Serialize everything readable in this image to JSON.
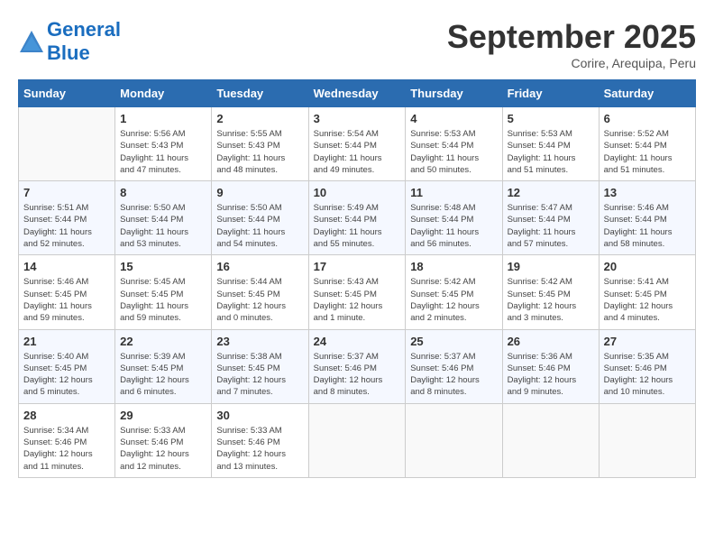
{
  "header": {
    "logo_line1": "General",
    "logo_line2": "Blue",
    "month": "September 2025",
    "location": "Corire, Arequipa, Peru"
  },
  "weekdays": [
    "Sunday",
    "Monday",
    "Tuesday",
    "Wednesday",
    "Thursday",
    "Friday",
    "Saturday"
  ],
  "weeks": [
    [
      {
        "day": "",
        "info": ""
      },
      {
        "day": "1",
        "info": "Sunrise: 5:56 AM\nSunset: 5:43 PM\nDaylight: 11 hours\nand 47 minutes."
      },
      {
        "day": "2",
        "info": "Sunrise: 5:55 AM\nSunset: 5:43 PM\nDaylight: 11 hours\nand 48 minutes."
      },
      {
        "day": "3",
        "info": "Sunrise: 5:54 AM\nSunset: 5:44 PM\nDaylight: 11 hours\nand 49 minutes."
      },
      {
        "day": "4",
        "info": "Sunrise: 5:53 AM\nSunset: 5:44 PM\nDaylight: 11 hours\nand 50 minutes."
      },
      {
        "day": "5",
        "info": "Sunrise: 5:53 AM\nSunset: 5:44 PM\nDaylight: 11 hours\nand 51 minutes."
      },
      {
        "day": "6",
        "info": "Sunrise: 5:52 AM\nSunset: 5:44 PM\nDaylight: 11 hours\nand 51 minutes."
      }
    ],
    [
      {
        "day": "7",
        "info": "Sunrise: 5:51 AM\nSunset: 5:44 PM\nDaylight: 11 hours\nand 52 minutes."
      },
      {
        "day": "8",
        "info": "Sunrise: 5:50 AM\nSunset: 5:44 PM\nDaylight: 11 hours\nand 53 minutes."
      },
      {
        "day": "9",
        "info": "Sunrise: 5:50 AM\nSunset: 5:44 PM\nDaylight: 11 hours\nand 54 minutes."
      },
      {
        "day": "10",
        "info": "Sunrise: 5:49 AM\nSunset: 5:44 PM\nDaylight: 11 hours\nand 55 minutes."
      },
      {
        "day": "11",
        "info": "Sunrise: 5:48 AM\nSunset: 5:44 PM\nDaylight: 11 hours\nand 56 minutes."
      },
      {
        "day": "12",
        "info": "Sunrise: 5:47 AM\nSunset: 5:44 PM\nDaylight: 11 hours\nand 57 minutes."
      },
      {
        "day": "13",
        "info": "Sunrise: 5:46 AM\nSunset: 5:44 PM\nDaylight: 11 hours\nand 58 minutes."
      }
    ],
    [
      {
        "day": "14",
        "info": "Sunrise: 5:46 AM\nSunset: 5:45 PM\nDaylight: 11 hours\nand 59 minutes."
      },
      {
        "day": "15",
        "info": "Sunrise: 5:45 AM\nSunset: 5:45 PM\nDaylight: 11 hours\nand 59 minutes."
      },
      {
        "day": "16",
        "info": "Sunrise: 5:44 AM\nSunset: 5:45 PM\nDaylight: 12 hours\nand 0 minutes."
      },
      {
        "day": "17",
        "info": "Sunrise: 5:43 AM\nSunset: 5:45 PM\nDaylight: 12 hours\nand 1 minute."
      },
      {
        "day": "18",
        "info": "Sunrise: 5:42 AM\nSunset: 5:45 PM\nDaylight: 12 hours\nand 2 minutes."
      },
      {
        "day": "19",
        "info": "Sunrise: 5:42 AM\nSunset: 5:45 PM\nDaylight: 12 hours\nand 3 minutes."
      },
      {
        "day": "20",
        "info": "Sunrise: 5:41 AM\nSunset: 5:45 PM\nDaylight: 12 hours\nand 4 minutes."
      }
    ],
    [
      {
        "day": "21",
        "info": "Sunrise: 5:40 AM\nSunset: 5:45 PM\nDaylight: 12 hours\nand 5 minutes."
      },
      {
        "day": "22",
        "info": "Sunrise: 5:39 AM\nSunset: 5:45 PM\nDaylight: 12 hours\nand 6 minutes."
      },
      {
        "day": "23",
        "info": "Sunrise: 5:38 AM\nSunset: 5:45 PM\nDaylight: 12 hours\nand 7 minutes."
      },
      {
        "day": "24",
        "info": "Sunrise: 5:37 AM\nSunset: 5:46 PM\nDaylight: 12 hours\nand 8 minutes."
      },
      {
        "day": "25",
        "info": "Sunrise: 5:37 AM\nSunset: 5:46 PM\nDaylight: 12 hours\nand 8 minutes."
      },
      {
        "day": "26",
        "info": "Sunrise: 5:36 AM\nSunset: 5:46 PM\nDaylight: 12 hours\nand 9 minutes."
      },
      {
        "day": "27",
        "info": "Sunrise: 5:35 AM\nSunset: 5:46 PM\nDaylight: 12 hours\nand 10 minutes."
      }
    ],
    [
      {
        "day": "28",
        "info": "Sunrise: 5:34 AM\nSunset: 5:46 PM\nDaylight: 12 hours\nand 11 minutes."
      },
      {
        "day": "29",
        "info": "Sunrise: 5:33 AM\nSunset: 5:46 PM\nDaylight: 12 hours\nand 12 minutes."
      },
      {
        "day": "30",
        "info": "Sunrise: 5:33 AM\nSunset: 5:46 PM\nDaylight: 12 hours\nand 13 minutes."
      },
      {
        "day": "",
        "info": ""
      },
      {
        "day": "",
        "info": ""
      },
      {
        "day": "",
        "info": ""
      },
      {
        "day": "",
        "info": ""
      }
    ]
  ]
}
